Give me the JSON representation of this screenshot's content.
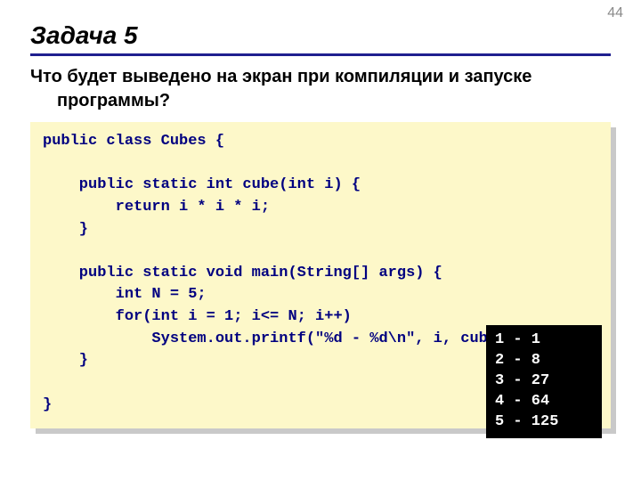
{
  "page_number": "44",
  "title": "Задача 5",
  "prompt_line1": "Что будет выведено на экран при компиляции и запуске",
  "prompt_line2": "программы?",
  "code": "public class Cubes {\n\n    public static int cube(int i) {\n        return i * i * i;\n    }\n\n    public static void main(String[] args) {\n        int N = 5;\n        for(int i = 1; i<= N; i++)\n            System.out.printf(\"%d - %d\\n\", i, cube(i));\n    }\n\n}",
  "output": "1 - 1\n2 - 8\n3 - 27\n4 - 64\n5 - 125"
}
